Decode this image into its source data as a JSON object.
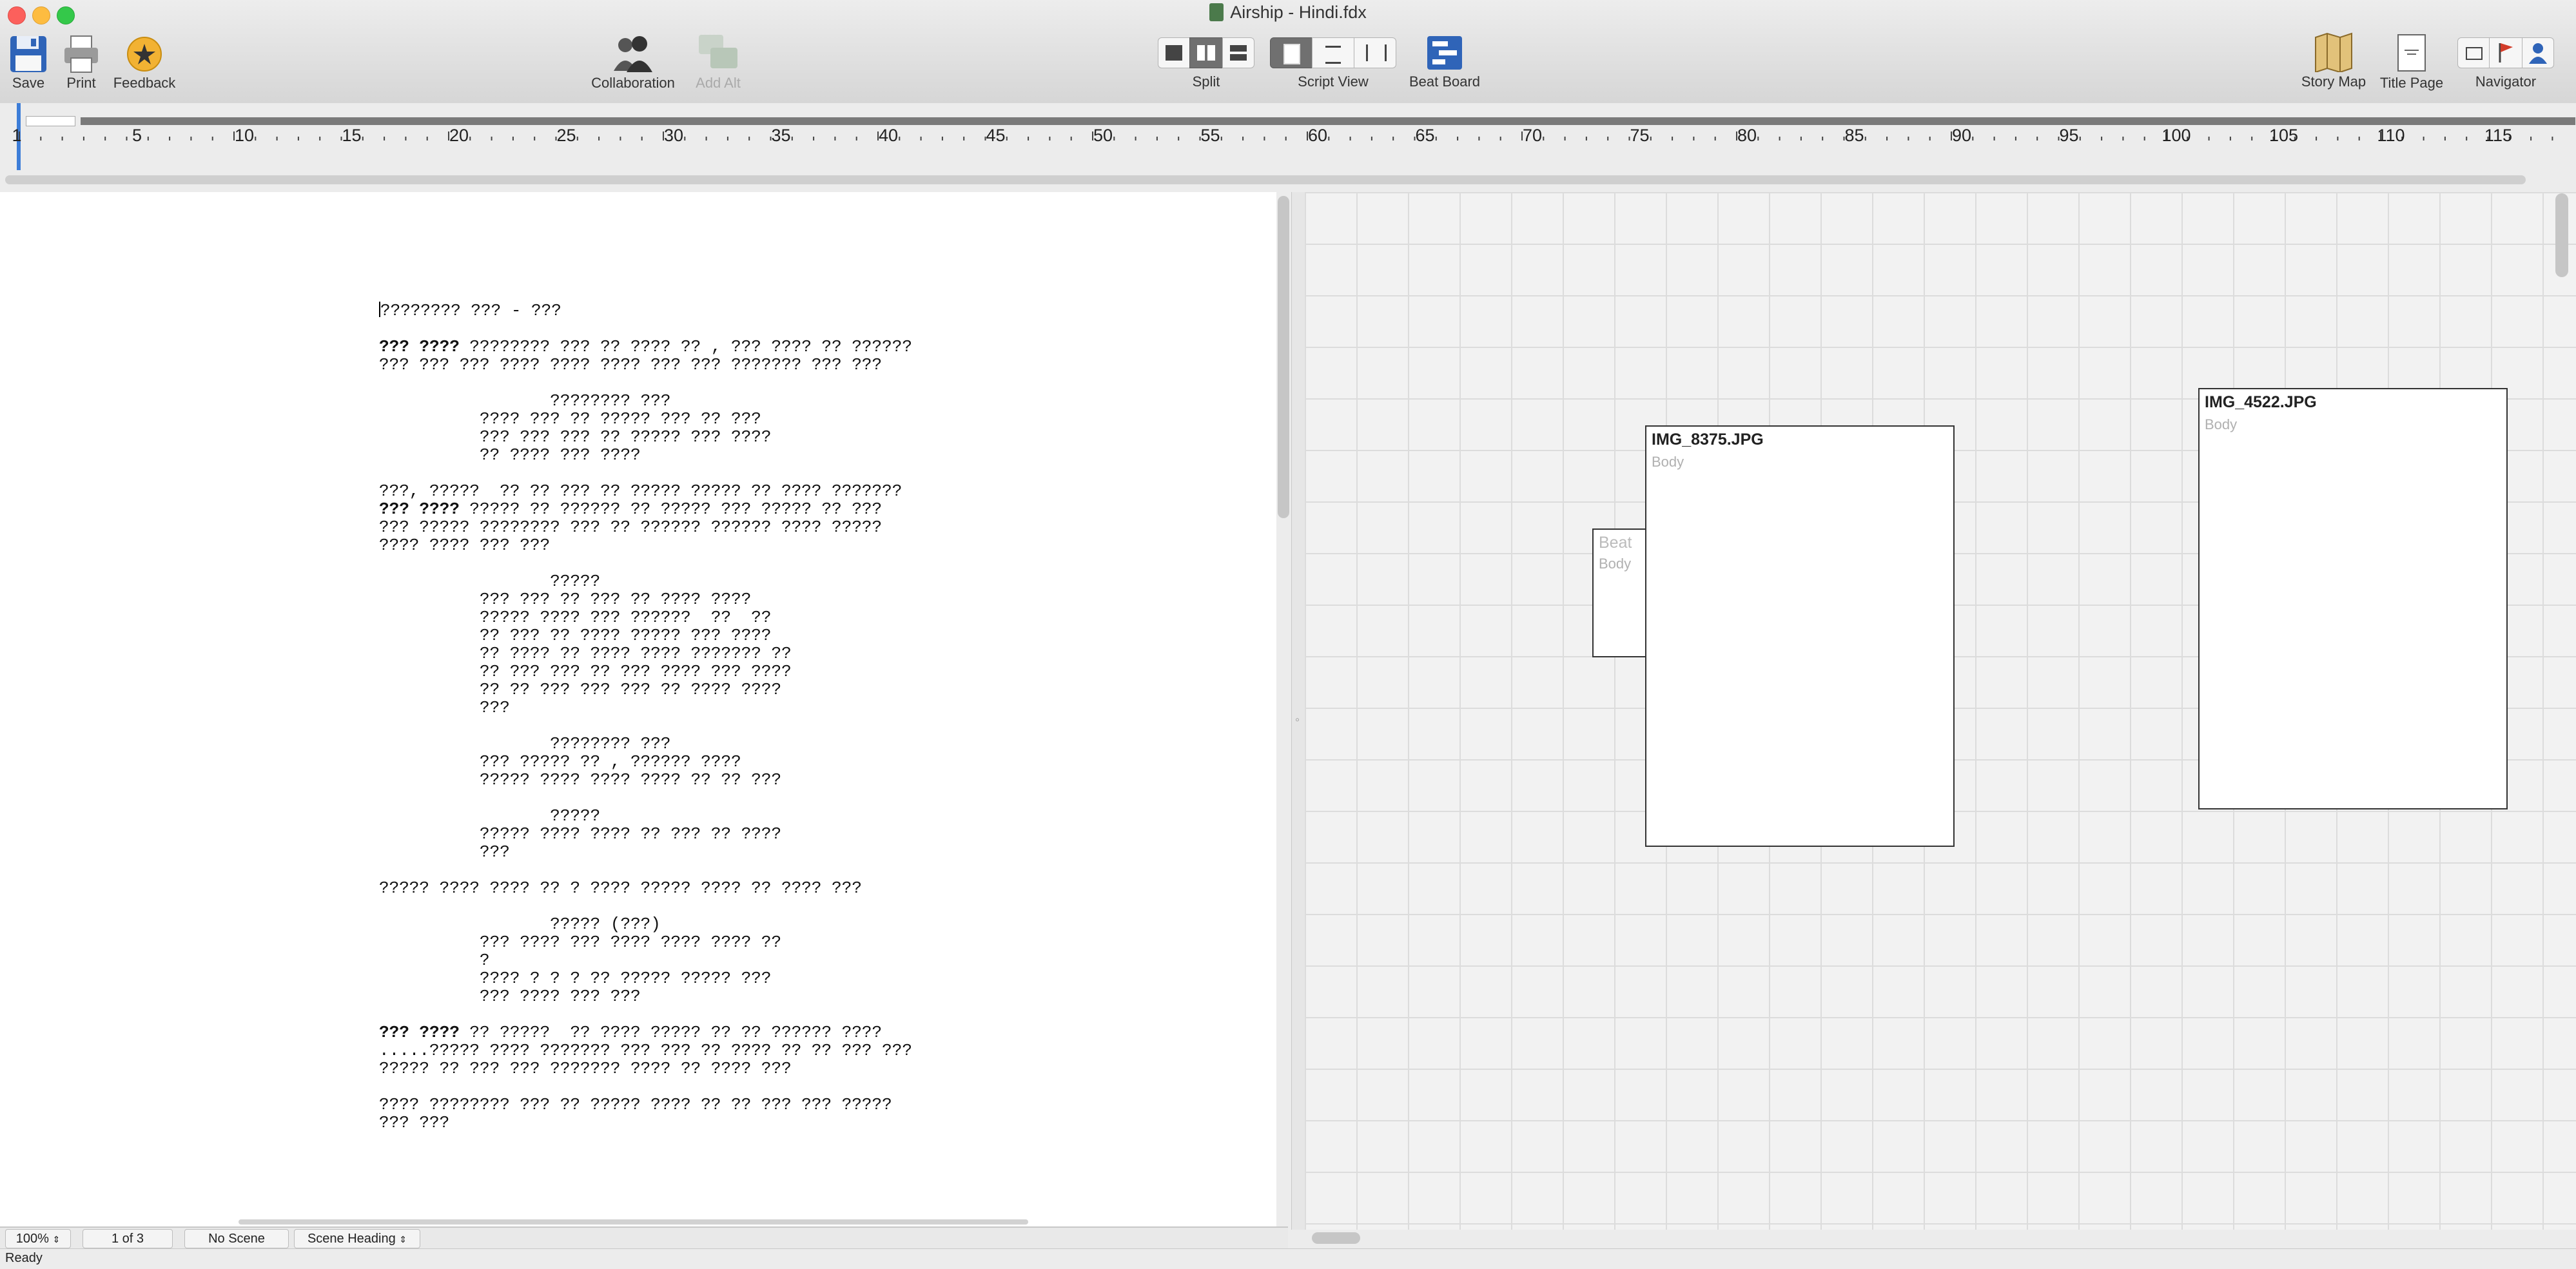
{
  "window": {
    "title": "Airship - Hindi.fdx"
  },
  "toolbar": {
    "save_label": "Save",
    "print_label": "Print",
    "feedback_label": "Feedback",
    "collaboration_label": "Collaboration",
    "add_alt_label": "Add Alt",
    "split_label": "Split",
    "script_view_label": "Script View",
    "beat_board_label": "Beat Board",
    "story_map_label": "Story Map",
    "title_page_label": "Title Page",
    "navigator_label": "Navigator"
  },
  "ruler": {
    "numbers": [
      "1",
      "5",
      "10",
      "15",
      "20",
      "25",
      "30",
      "35",
      "40",
      "45",
      "50",
      "55",
      "60",
      "65",
      "70",
      "75",
      "80",
      "85",
      "90",
      "95",
      "100",
      "105",
      "110",
      "115"
    ]
  },
  "script": {
    "lines": [
      "???????? ??? - ???",
      "",
      "??? ???? ???????? ??? ?? ???? ?? , ??? ???? ?? ??????",
      "??? ??? ??? ???? ???? ???? ??? ??? ??????? ??? ???",
      "",
      "                 ???????? ???",
      "          ???? ??? ?? ????? ??? ?? ???",
      "          ??? ??? ??? ?? ????? ??? ????",
      "          ?? ???? ??? ????",
      "",
      "???, ?????  ?? ?? ??? ?? ????? ????? ?? ???? ???????",
      "??? ???? ????? ?? ?????? ?? ????? ??? ????? ?? ???",
      "??? ????? ???????? ??? ?? ?????? ?????? ???? ?????",
      "???? ???? ??? ???",
      "",
      "                 ?????",
      "          ??? ??? ?? ??? ?? ???? ????",
      "          ????? ???? ??? ??????  ??  ??",
      "          ?? ??? ?? ???? ????? ??? ????",
      "          ?? ???? ?? ???? ???? ??????? ??",
      "          ?? ??? ??? ?? ??? ???? ??? ????",
      "          ?? ?? ??? ??? ??? ?? ???? ????",
      "          ???",
      "",
      "                 ???????? ???",
      "          ??? ????? ?? , ?????? ????",
      "          ????? ???? ???? ???? ?? ?? ???",
      "",
      "                 ?????",
      "          ????? ???? ???? ?? ??? ?? ????",
      "          ???",
      "",
      "????? ???? ???? ?? ? ???? ????? ???? ?? ???? ???",
      "",
      "                 ????? (???)",
      "          ??? ???? ??? ???? ???? ???? ??",
      "          ?",
      "          ???? ? ? ? ?? ????? ????? ???",
      "          ??? ???? ??? ???",
      "",
      "??? ???? ?? ?????  ?? ???? ????? ?? ?? ?????? ????",
      ".....????? ???? ??????? ??? ??? ?? ???? ?? ?? ??? ???",
      "????? ?? ??? ??? ??????? ???? ?? ???? ???",
      "",
      "???? ???????? ??? ?? ????? ???? ?? ?? ??? ??? ?????",
      "??? ???"
    ]
  },
  "status": {
    "zoom": "100%",
    "page": "1 of 3",
    "scene": "No Scene",
    "element": "Scene Heading",
    "ready": "Ready"
  },
  "beat_board": {
    "cards": [
      {
        "title": "Beat",
        "body": "Body"
      },
      {
        "title": "IMG_8375.JPG",
        "body": "Body"
      },
      {
        "title": "IMG_4522.JPG",
        "body": "Body"
      }
    ]
  },
  "colors": {
    "accent": "#3d7dd8",
    "toolbar_bg": "#dcdcdc",
    "beat_board_bg": "#f2f2f2"
  }
}
